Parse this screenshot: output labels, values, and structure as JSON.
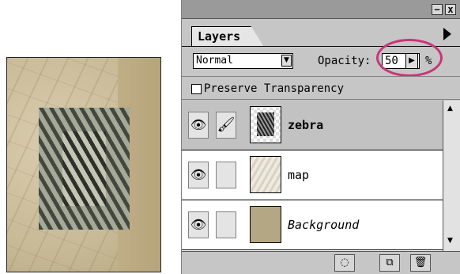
{
  "palette": {
    "tab_label": "Layers",
    "blend_mode": "Normal",
    "opacity_label": "Opacity:",
    "opacity_value": "50",
    "percent": "%",
    "preserve_label": "Preserve Transparency",
    "minimize_glyph": "−",
    "close_glyph": "x"
  },
  "layers": [
    {
      "name": "zebra",
      "selected": true
    },
    {
      "name": "map",
      "selected": false
    },
    {
      "name": "Background",
      "selected": false
    }
  ],
  "colors": {
    "highlight": "#c8357a",
    "palette_bg": "#c6c6c6",
    "background_layer": "#b3a883"
  }
}
